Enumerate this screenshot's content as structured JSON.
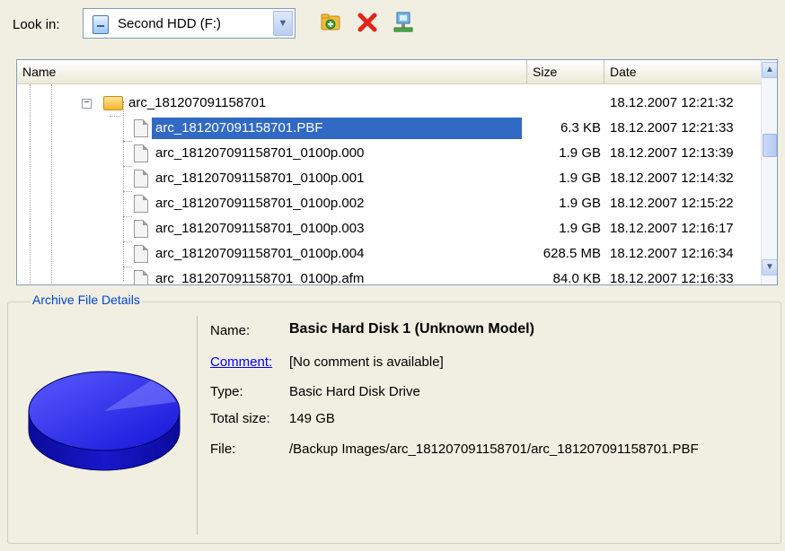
{
  "toolbar": {
    "look_in_label": "Look in:",
    "drive": "Second HDD (F:)"
  },
  "columns": {
    "name": "Name",
    "size": "Size",
    "date": "Date"
  },
  "files": [
    {
      "name": "arc_181207091158701",
      "size": "",
      "date": "18.12.2007 12:21:32",
      "type": "folder"
    },
    {
      "name": "arc_181207091158701.PBF",
      "size": "6.3 KB",
      "date": "18.12.2007 12:21:33",
      "type": "file",
      "selected": true
    },
    {
      "name": "arc_181207091158701_0100p.000",
      "size": "1.9 GB",
      "date": "18.12.2007 12:13:39",
      "type": "file"
    },
    {
      "name": "arc_181207091158701_0100p.001",
      "size": "1.9 GB",
      "date": "18.12.2007 12:14:32",
      "type": "file"
    },
    {
      "name": "arc_181207091158701_0100p.002",
      "size": "1.9 GB",
      "date": "18.12.2007 12:15:22",
      "type": "file"
    },
    {
      "name": "arc_181207091158701_0100p.003",
      "size": "1.9 GB",
      "date": "18.12.2007 12:16:17",
      "type": "file"
    },
    {
      "name": "arc_181207091158701_0100p.004",
      "size": "628.5 MB",
      "date": "18.12.2007 12:16:34",
      "type": "file"
    },
    {
      "name": "arc_181207091158701_0100p.afm",
      "size": "84.0 KB",
      "date": "18.12.2007 12:16:33",
      "type": "file"
    }
  ],
  "details": {
    "section_label": "Archive File Details",
    "name_label": "Name:",
    "name_value": "Basic Hard Disk 1 (Unknown Model)",
    "comment_label": "Comment:",
    "comment_value": "[No comment is available]",
    "type_label": "Type:",
    "type_value": "Basic Hard Disk Drive",
    "total_size_label": "Total size:",
    "total_size_value": "149 GB",
    "file_label": "File:",
    "file_value": "/Backup Images/arc_181207091158701/arc_181207091158701.PBF"
  },
  "colors": {
    "selection": "#316ac5",
    "link": "#0000ff",
    "section_label": "#0046d5",
    "disk": "#1e1ee6"
  }
}
